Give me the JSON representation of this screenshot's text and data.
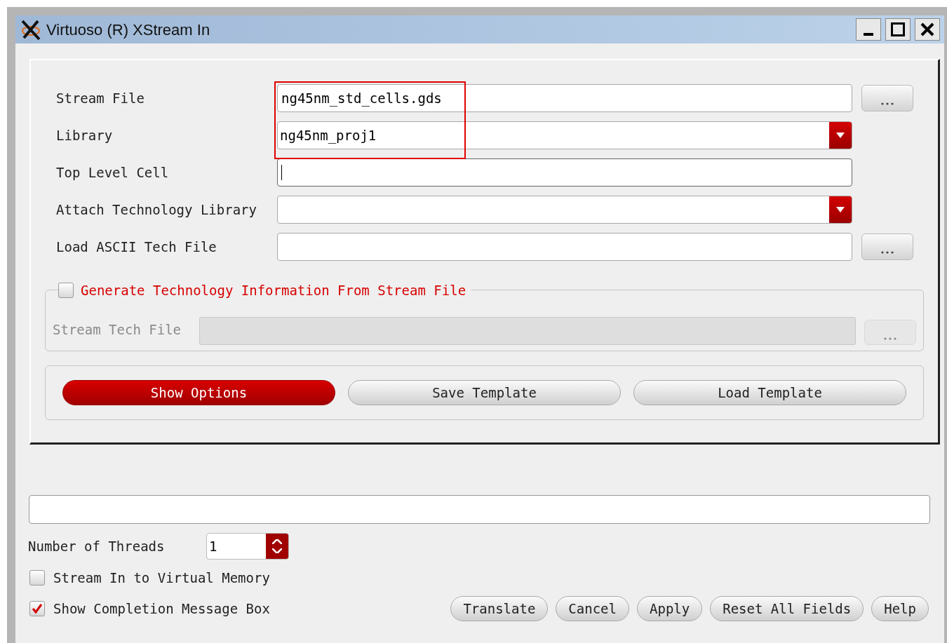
{
  "window": {
    "title": "Virtuoso (R) XStream In"
  },
  "fields": [
    {
      "label": "Stream File",
      "kind": "text",
      "value": "ng45nm_std_cells.gds",
      "browse": true,
      "focused": false
    },
    {
      "label": "Library",
      "kind": "combo",
      "value": "ng45nm_proj1",
      "browse": false,
      "focused": false
    },
    {
      "label": "Top Level Cell",
      "kind": "text",
      "browse": false,
      "focused": true
    },
    {
      "label": "Attach Technology Library",
      "kind": "combo",
      "browse": false,
      "focused": false
    },
    {
      "label": "Load ASCII Tech File",
      "kind": "text",
      "browse": true,
      "focused": false
    }
  ],
  "tech_group": {
    "label": "Generate Technology Information From Stream File",
    "checked": false,
    "field_label": "Stream Tech File",
    "disabled": true
  },
  "option_buttons": [
    {
      "label": "Show Options",
      "primary": true
    },
    {
      "label": "Save Template",
      "primary": false
    },
    {
      "label": "Load Template",
      "primary": false
    }
  ],
  "threads": {
    "label": "Number of Threads",
    "value": "1"
  },
  "checkboxes": [
    {
      "label": "Stream In to Virtual Memory",
      "checked": false
    },
    {
      "label": "Show Completion Message Box",
      "checked": true
    }
  ],
  "buttons": [
    "Translate",
    "Cancel",
    "Apply",
    "Reset All Fields",
    "Help"
  ]
}
